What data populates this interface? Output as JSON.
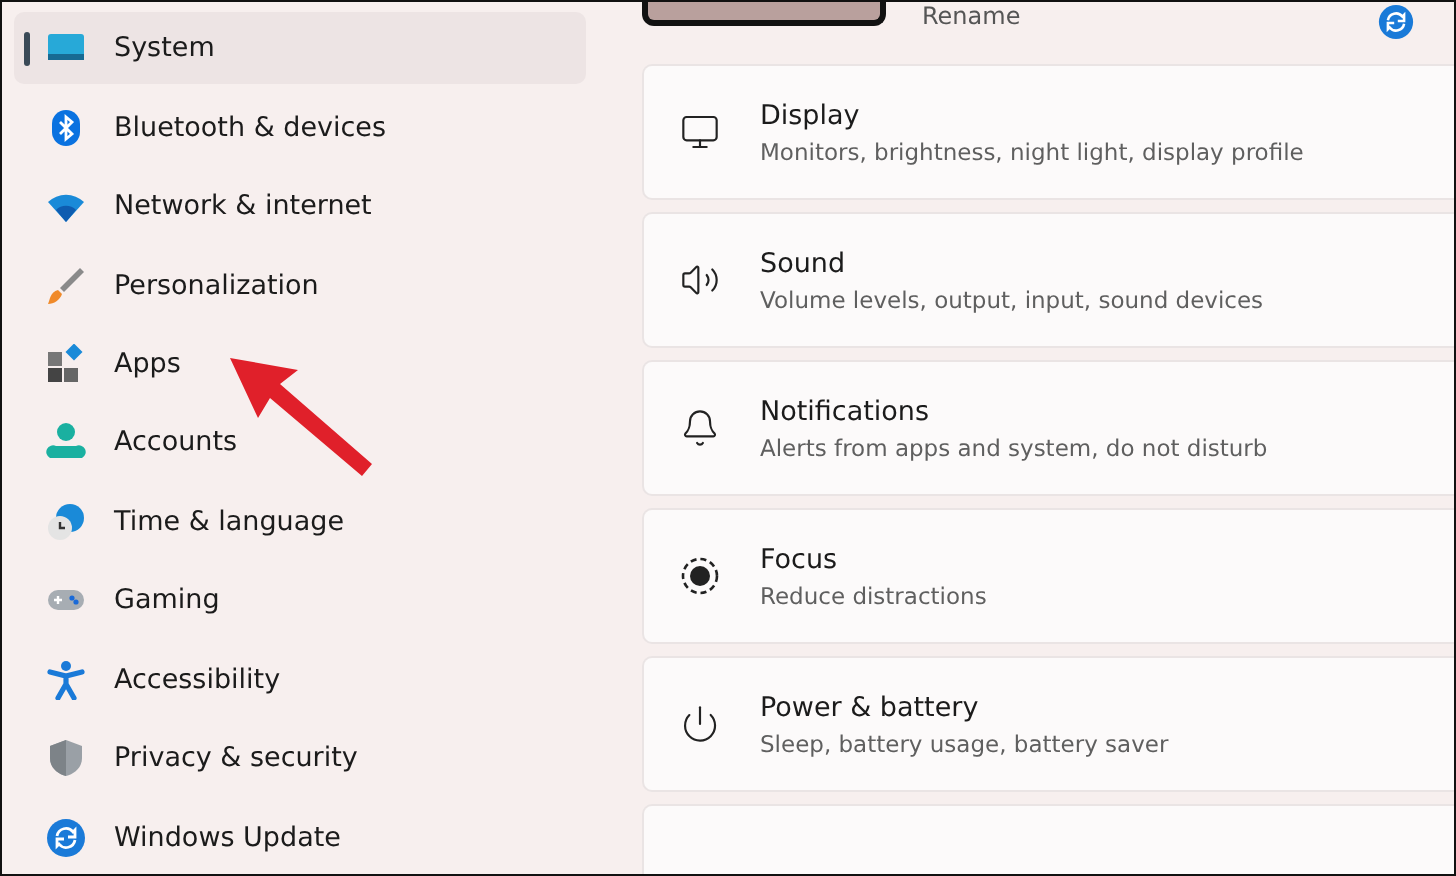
{
  "sidebar": {
    "items": [
      {
        "label": "System",
        "kind": "system",
        "selected": true
      },
      {
        "label": "Bluetooth & devices",
        "kind": "bluetooth",
        "selected": false
      },
      {
        "label": "Network & internet",
        "kind": "wifi",
        "selected": false
      },
      {
        "label": "Personalization",
        "kind": "brush",
        "selected": false
      },
      {
        "label": "Apps",
        "kind": "apps",
        "selected": false
      },
      {
        "label": "Accounts",
        "kind": "person",
        "selected": false
      },
      {
        "label": "Time & language",
        "kind": "time",
        "selected": false
      },
      {
        "label": "Gaming",
        "kind": "gamepad",
        "selected": false
      },
      {
        "label": "Accessibility",
        "kind": "accessibility",
        "selected": false
      },
      {
        "label": "Privacy & security",
        "kind": "shield",
        "selected": false
      },
      {
        "label": "Windows Update",
        "kind": "update",
        "selected": false
      }
    ]
  },
  "header": {
    "rename": "Rename"
  },
  "cards": [
    {
      "title": "Display",
      "subtitle": "Monitors, brightness, night light, display profile",
      "kind": "monitor"
    },
    {
      "title": "Sound",
      "subtitle": "Volume levels, output, input, sound devices",
      "kind": "speaker"
    },
    {
      "title": "Notifications",
      "subtitle": "Alerts from apps and system, do not disturb",
      "kind": "bell"
    },
    {
      "title": "Focus",
      "subtitle": "Reduce distractions",
      "kind": "focus"
    },
    {
      "title": "Power & battery",
      "subtitle": "Sleep, battery usage, battery saver",
      "kind": "power"
    },
    {
      "kind": "blank"
    }
  ]
}
